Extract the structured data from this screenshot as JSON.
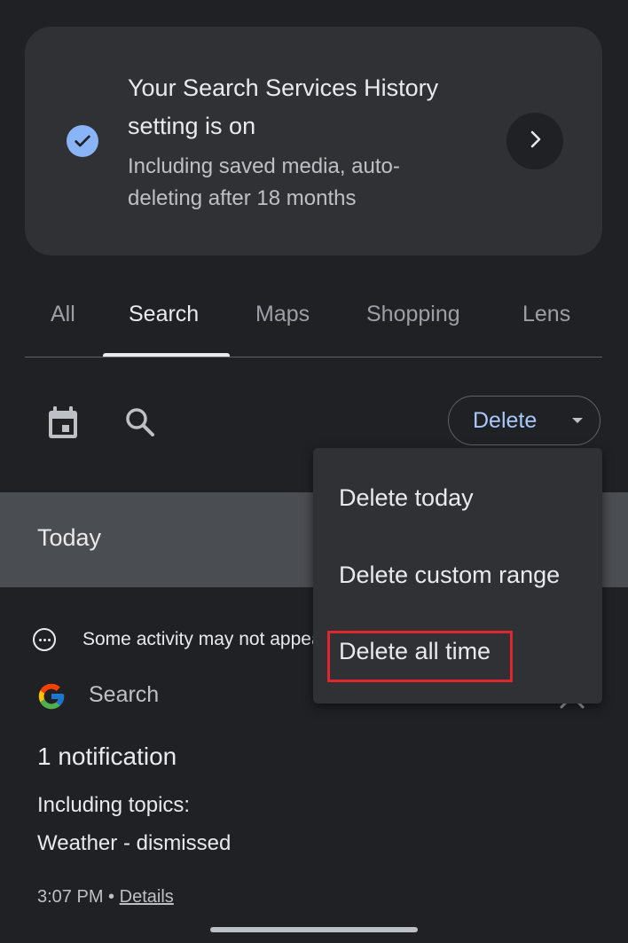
{
  "card": {
    "title": "Your Search Services History setting is on",
    "subtitle": "Including saved media, auto-deleting after 18 months",
    "status_color": "#8ab4f8"
  },
  "tabs": [
    {
      "label": "All",
      "active": false
    },
    {
      "label": "Search",
      "active": true
    },
    {
      "label": "Maps",
      "active": false
    },
    {
      "label": "Shopping",
      "active": false
    },
    {
      "label": "Lens",
      "active": false
    }
  ],
  "toolbar": {
    "calendar_icon": "calendar-icon",
    "search_icon": "search-icon",
    "delete_label": "Delete"
  },
  "delete_menu": {
    "items": [
      "Delete today",
      "Delete custom range",
      "Delete all time"
    ],
    "highlighted_item": "Delete all time",
    "highlight_color": "#e0262d"
  },
  "section": {
    "today_label": "Today"
  },
  "activity": {
    "notice": "Some activity may not appear yet",
    "service": "Search",
    "notification_title": "1 notification",
    "topics_label": "Including topics:",
    "topic": "Weather - dismissed",
    "time": "3:07 PM",
    "separator": "•",
    "details_link": "Details"
  }
}
